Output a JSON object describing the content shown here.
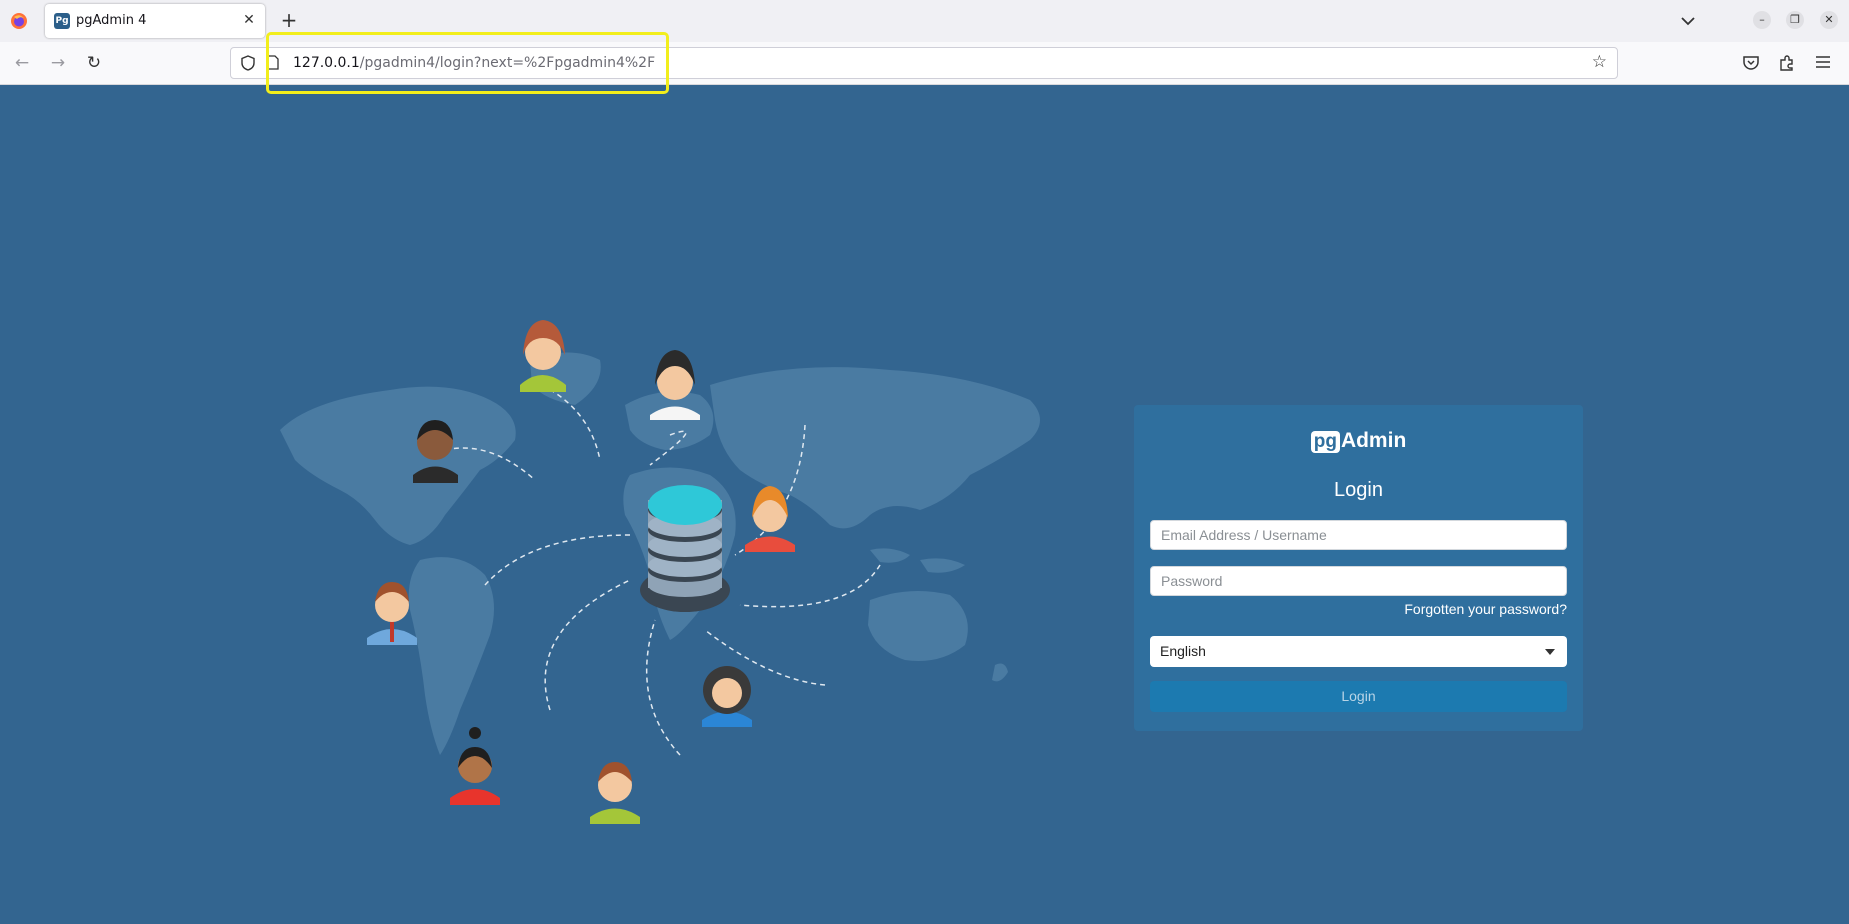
{
  "browser": {
    "tab_title": "pgAdmin 4",
    "tab_favicon_text": "Pg",
    "url_host": "127.0.0.1",
    "url_path": "/pgadmin4/login?next=%2Fpgadmin4%2F"
  },
  "brand": {
    "pg": "pg",
    "name": "Admin"
  },
  "login": {
    "title": "Login",
    "email_placeholder": "Email Address / Username",
    "password_placeholder": "Password",
    "forgot_label": "Forgotten your password?",
    "language_selected": "English",
    "submit_label": "Login"
  },
  "colors": {
    "page_background": "#336590",
    "panel_background": "#2f6f9e",
    "button_background": "#1c7ab0",
    "highlight": "#f2ee1c"
  },
  "icons": [
    "firefox-logo-icon",
    "close-icon",
    "plus-icon",
    "chevron-down-icon",
    "back-arrow-icon",
    "forward-arrow-icon",
    "reload-icon",
    "shield-icon",
    "page-icon",
    "star-icon",
    "pocket-icon",
    "extensions-icon",
    "menu-icon"
  ]
}
